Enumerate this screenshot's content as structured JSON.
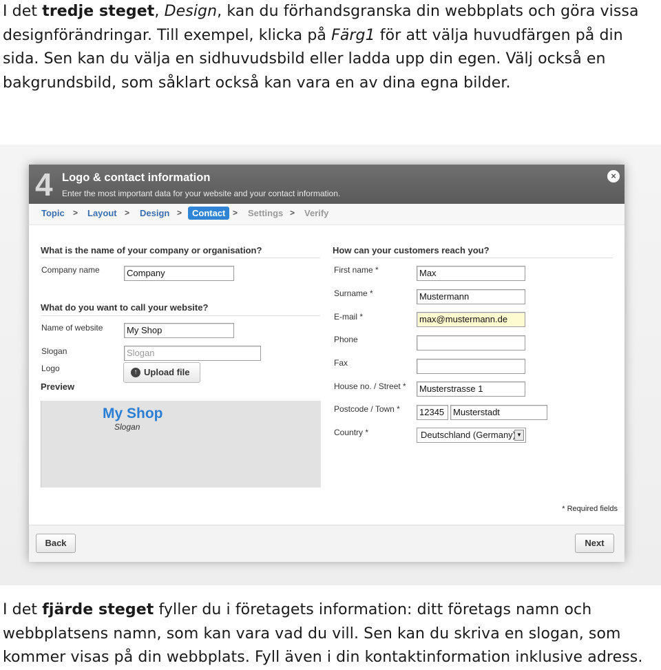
{
  "intro": {
    "p1": "I det ",
    "b1": "tredje steget",
    "p2": ", ",
    "i1": "Design",
    "p3": ", kan du förhandsgranska din webbplats och göra vissa designförändringar. Till exempel, klicka på ",
    "i2": "Färg1",
    "p4": " för att välja huvudfärgen på din sida. Sen kan du välja en sidhuvudsbild eller ladda upp din egen. Välj också en bakgrundsbild, som såklart också kan vara en av dina egna bilder."
  },
  "dialog": {
    "step_number": "4",
    "title": "Logo & contact information",
    "subtitle": "Enter the most important data for your website and your contact information.",
    "close_icon": "×"
  },
  "breadcrumb": {
    "items": [
      "Topic",
      "Layout",
      "Design",
      "Contact",
      "Settings",
      "Verify"
    ],
    "separator": ">",
    "active": "Contact"
  },
  "left": {
    "company_heading": "What is the name of your company or organisation?",
    "company_label": "Company name",
    "company_value": "Company",
    "website_heading": "What do you want to call your website?",
    "website_label": "Name of website",
    "website_value": "My Shop",
    "slogan_label": "Slogan",
    "slogan_placeholder": "Slogan",
    "logo_label": "Logo",
    "upload_label": "Upload file",
    "upload_icon": "upload-icon",
    "preview_heading": "Preview",
    "preview_name": "My Shop",
    "preview_slogan": "Slogan"
  },
  "right": {
    "heading": "How can your customers reach you?",
    "first_name_label": "First name *",
    "first_name_value": "Max",
    "surname_label": "Surname *",
    "surname_value": "Mustermann",
    "email_label": "E-mail *",
    "email_value": "max@mustermann.de",
    "phone_label": "Phone",
    "phone_value": "",
    "fax_label": "Fax",
    "fax_value": "",
    "street_label": "House no. / Street *",
    "street_value": "Musterstrasse 1",
    "postcode_label": "Postcode / Town *",
    "postcode_value": "12345",
    "town_value": "Musterstadt",
    "country_label": "Country *",
    "country_value": "Deutschland (Germany)"
  },
  "required_note": "* Required fields",
  "footer": {
    "back_label": "Back",
    "next_label": "Next"
  },
  "outro": {
    "p1": "I det ",
    "b1": "fjärde steget",
    "p2": " fyller du i företagets information: ditt företags namn och webbplatsens namn, som kan vara vad du vill. Sen kan du skriva en slogan, som kommer visas på din webbplats. Fyll även i din kontaktinformation inklusive adress."
  },
  "colors": {
    "accent": "#2f84d6",
    "header": "#636363",
    "link": "#3b6fb0",
    "preview_name": "#2a7fd4"
  }
}
